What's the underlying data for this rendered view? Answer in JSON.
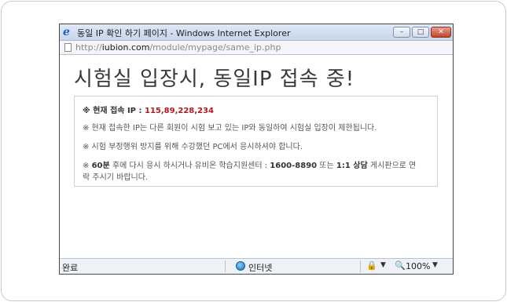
{
  "window": {
    "title": "동일 IP 확인 하기 페이지 - Windows Internet Explorer",
    "address_prefix": "http://",
    "address_domain": "iubion.com",
    "address_path": "/module/mypage/same_ip.php"
  },
  "page": {
    "headline": "시험실 입장시, 동일IP 접속 중!",
    "notice": {
      "line1_label": "※ 현재 접속 IP : ",
      "line1_ip": "115,89,228,234",
      "line2": "※ 현재 접속한 IP는 다른 회원이 시험 보고 있는 IP와 동일하여 시험실 입장이 제한됩니다.",
      "line3": "※ 시험 부정행위 방지를 위해 수강했던 PC에서 응시하셔야 합니다.",
      "line4_a": "※ ",
      "line4_b": "60분",
      "line4_c": " 후에 다시 응시 하시거나 유비온 학습지원센터 : ",
      "line4_d": "1600-8890",
      "line4_e": " 또는 ",
      "line4_f": "1:1 상담",
      "line4_g": " 게시판으로 연",
      "line5": "락 주시기 바랍니다."
    }
  },
  "statusbar": {
    "status": "완료",
    "zone": "인터넷",
    "zoom": "100%"
  },
  "icons": {
    "browser": "ie-logo-icon",
    "globe": "globe-icon",
    "zoom": "zoom-icon"
  }
}
